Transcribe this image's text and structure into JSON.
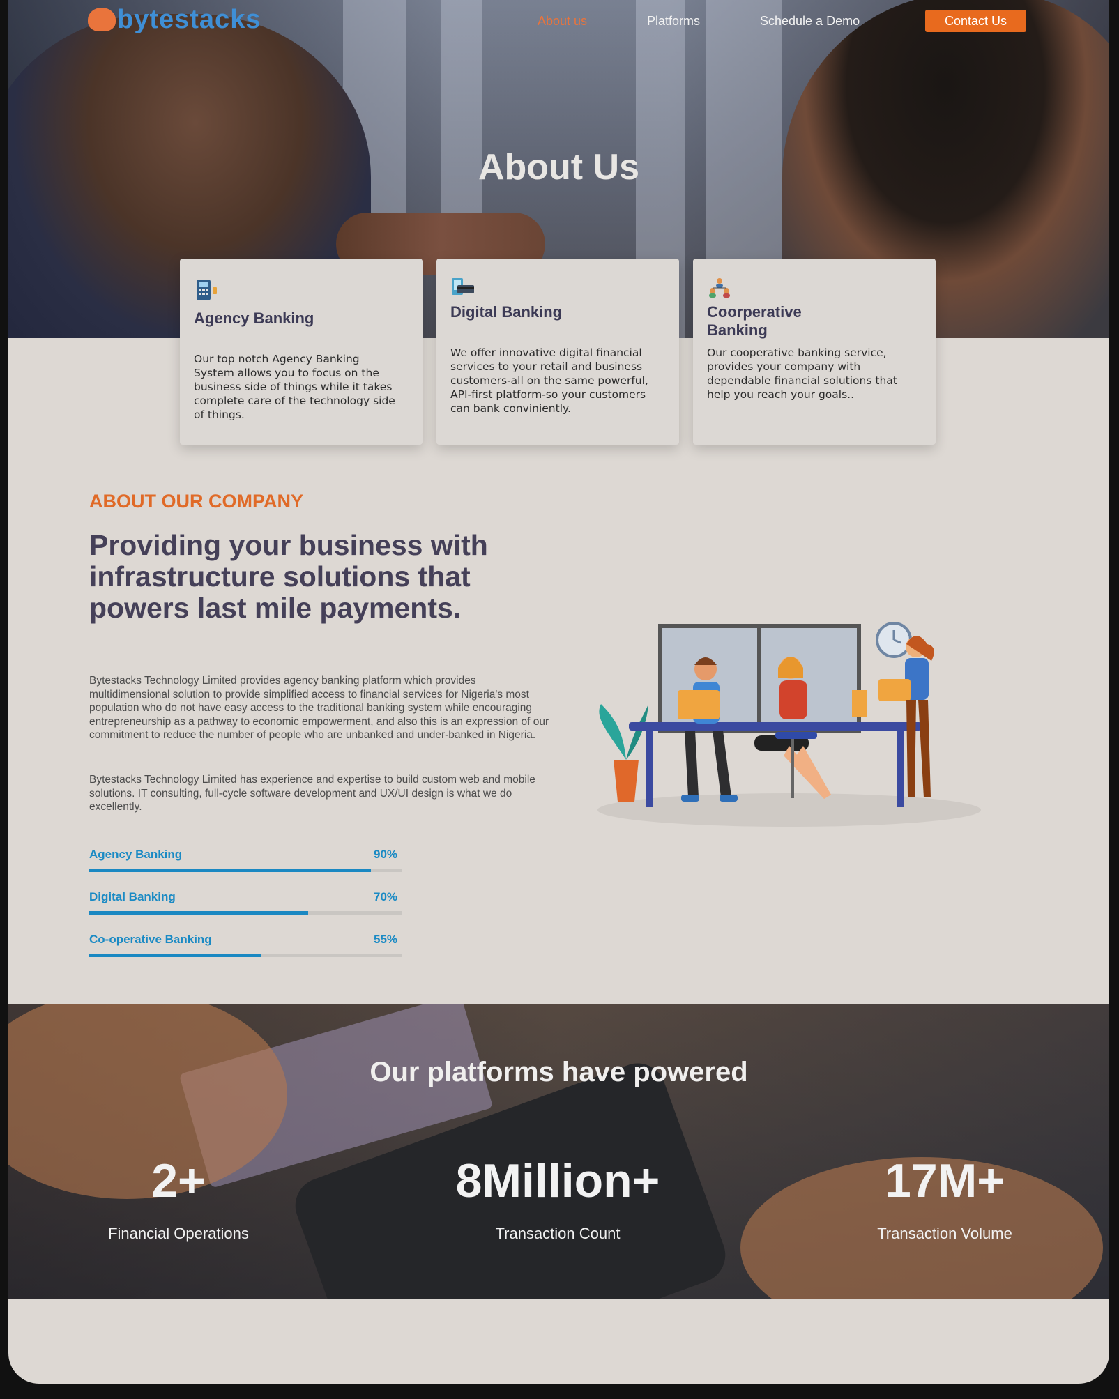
{
  "brand": {
    "name": "bytestacks",
    "accent": "#e86a1e",
    "primary": "#3f8fd6"
  },
  "nav": {
    "links": [
      "About us",
      "Platforms",
      "Schedule a Demo"
    ],
    "contact_label": "Contact Us"
  },
  "hero": {
    "title": "About Us"
  },
  "cards": [
    {
      "icon": "pos-terminal-icon",
      "title": "Agency Banking",
      "body": "Our top notch Agency Banking System allows you to focus on the business side of things while it takes complete care of the technology side of things."
    },
    {
      "icon": "digital-card-icon",
      "title": "Digital Banking",
      "body": "We offer innovative digital financial services to your retail and business customers-all on the same powerful, API-first platform-so your customers can bank conviniently."
    },
    {
      "icon": "cooperative-people-icon",
      "title": "Coorperative Banking",
      "body": "Our cooperative banking service, provides your company with dependable financial solutions that help you reach your goals.."
    }
  ],
  "about": {
    "kicker": "ABOUT OUR COMPANY",
    "headline": "Providing your business with infrastructure solutions that powers last mile payments.",
    "paragraph1": "Bytestacks Technology Limited provides agency banking platform which provides multidimensional solution to provide simplified access to financial services for Nigeria's most population who do not have easy access to the traditional banking system while encouraging entrepreneurship as a pathway to economic empowerment, and also this is an expression of our commitment to reduce the number of people who are unbanked and under-banked in Nigeria.",
    "paragraph2": "Bytestacks Technology Limited has experience and expertise to build custom web and mobile solutions. IT consulting, full-cycle software development and UX/UI design is what we do excellently.",
    "skills": [
      {
        "label": "Agency Banking",
        "pct_label": "90%",
        "value": 0.9
      },
      {
        "label": "Digital Banking",
        "pct_label": "70%",
        "value": 0.7
      },
      {
        "label": "Co-operative Banking",
        "pct_label": "55%",
        "value": 0.55
      }
    ]
  },
  "stats": {
    "title": "Our platforms have powered",
    "items": [
      {
        "value": "2+",
        "label": "Financial Operations"
      },
      {
        "value": "8Million+",
        "label": "Transaction Count"
      },
      {
        "value": "17M+",
        "label": "Transaction Volume"
      }
    ]
  }
}
